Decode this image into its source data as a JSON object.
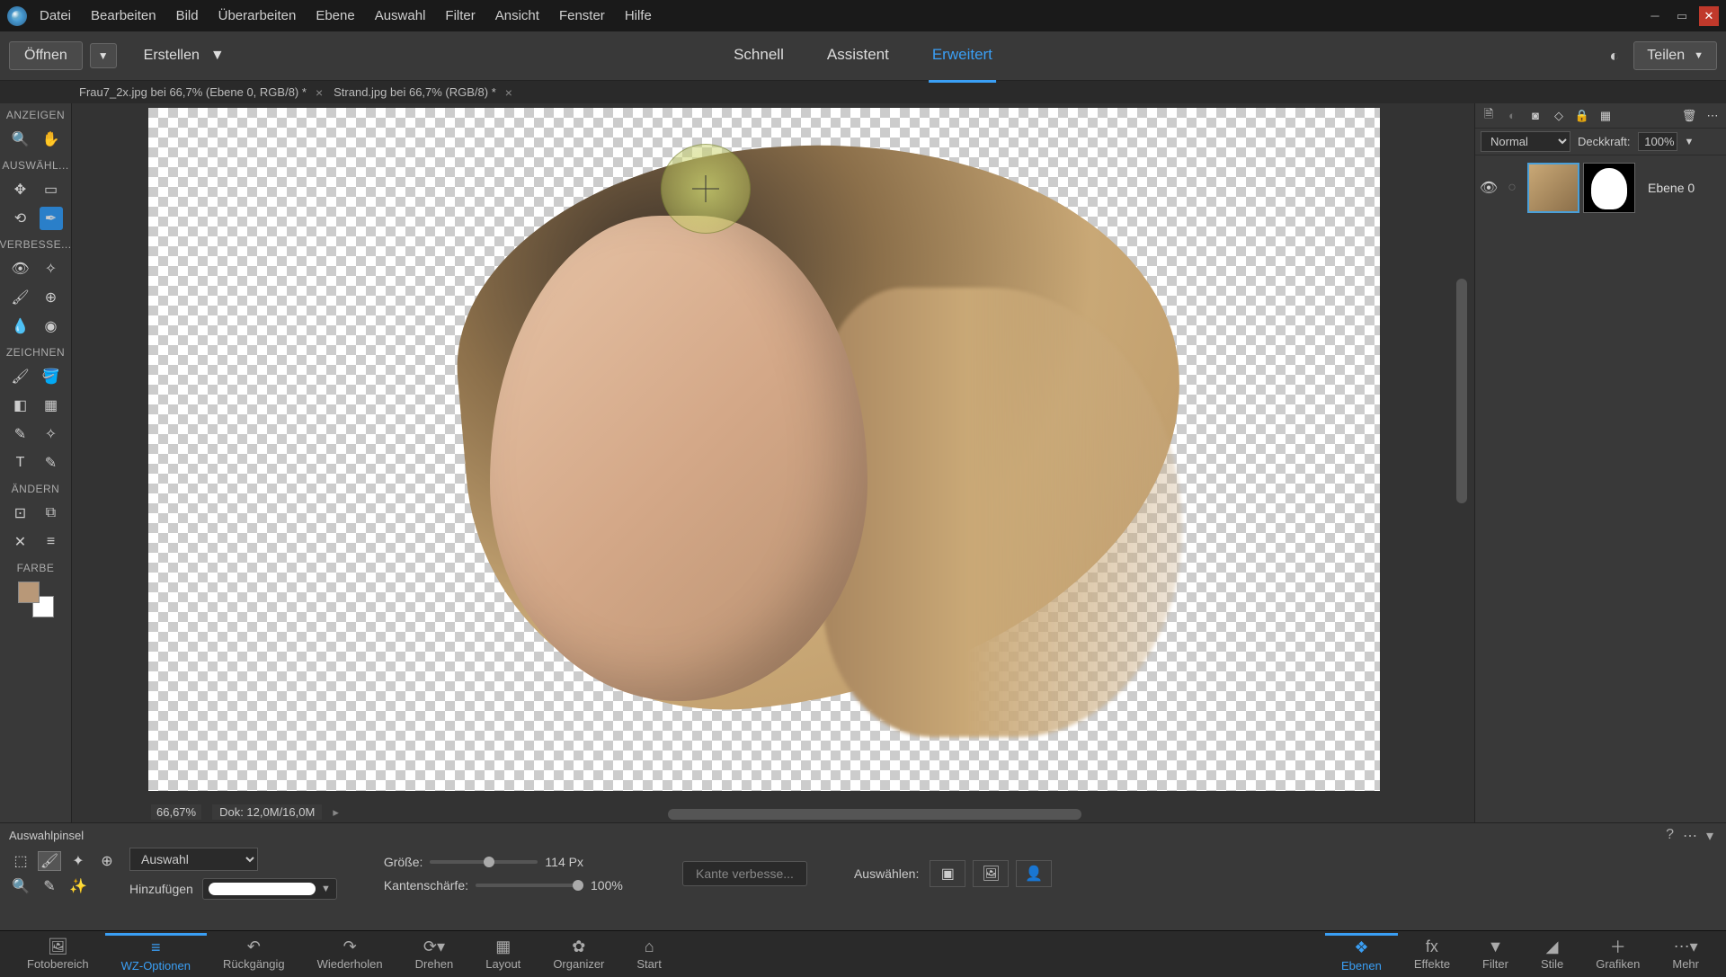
{
  "menu": {
    "file": "Datei",
    "edit": "Bearbeiten",
    "image": "Bild",
    "enhance": "Überarbeiten",
    "layer": "Ebene",
    "select": "Auswahl",
    "filter": "Filter",
    "view": "Ansicht",
    "window": "Fenster",
    "help": "Hilfe"
  },
  "toolbar": {
    "open": "Öffnen",
    "create": "Erstellen",
    "share": "Teilen"
  },
  "modes": {
    "quick": "Schnell",
    "guided": "Assistent",
    "expert": "Erweitert"
  },
  "tabs": [
    {
      "label": "Frau7_2x.jpg bei 66,7% (Ebene 0, RGB/8) *"
    },
    {
      "label": "Strand.jpg bei 66,7% (RGB/8) *"
    }
  ],
  "leftbar": {
    "view": "ANZEIGEN",
    "select": "AUSWÄHL...",
    "enhance": "VERBESSE...",
    "draw": "ZEICHNEN",
    "modify": "ÄNDERN",
    "color": "FARBE"
  },
  "status": {
    "zoom": "66,67%",
    "doc": "Dok:  12,0M/16,0M"
  },
  "layers": {
    "blend_mode": "Normal",
    "opacity_label": "Deckkraft:",
    "opacity": "100%",
    "layer0": "Ebene 0"
  },
  "options": {
    "tool_name": "Auswahlpinsel",
    "add_label": "Hinzufügen",
    "mode_dd": "Auswahl",
    "size_label": "Größe:",
    "size_value": "114 Px",
    "hardness_label": "Kantenschärfe:",
    "hardness_value": "100%",
    "refine": "Kante verbesse...",
    "select_label": "Auswählen:"
  },
  "bottombar": {
    "photobin": "Fotobereich",
    "tooloptions": "WZ-Optionen",
    "undo": "Rückgängig",
    "redo": "Wiederholen",
    "rotate": "Drehen",
    "layout": "Layout",
    "organizer": "Organizer",
    "home": "Start",
    "layers": "Ebenen",
    "effects": "Effekte",
    "filters": "Filter",
    "styles": "Stile",
    "graphics": "Grafiken",
    "more": "Mehr"
  }
}
